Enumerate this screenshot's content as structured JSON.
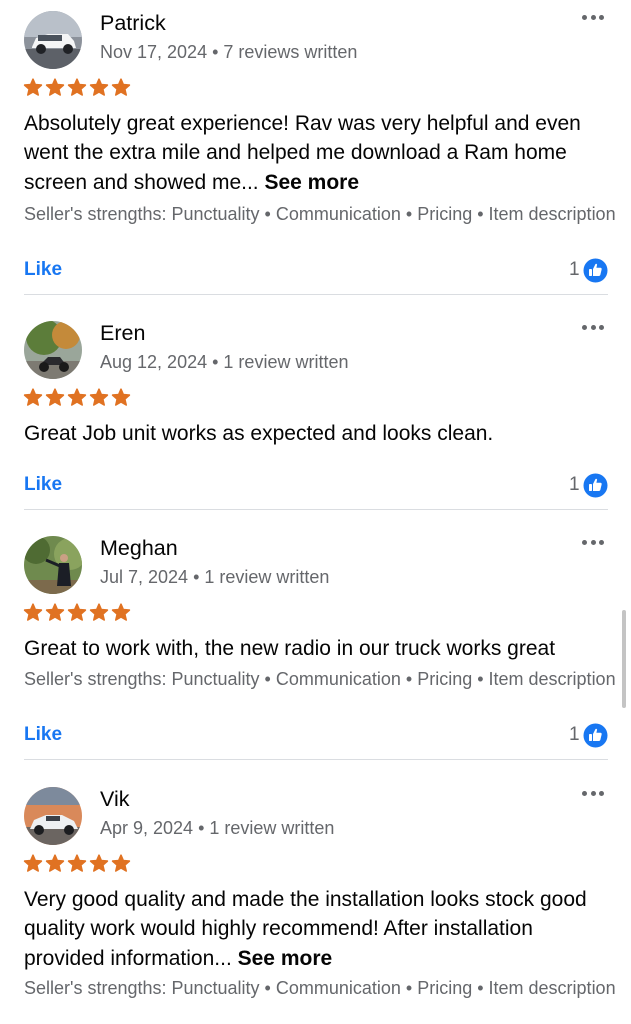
{
  "colors": {
    "star": "#e07222",
    "link": "#1877f2",
    "secondary_text": "#65676b",
    "divider": "#dadde1"
  },
  "reviews": [
    {
      "name": "Patrick",
      "date": "Nov 17, 2024",
      "review_count": "7 reviews written",
      "rating": 5,
      "text": "Absolutely great experience! Rav was very helpful and even went the extra mile and helped me download a Ram home screen and showed me...",
      "see_more": "See more",
      "strengths": "Seller's strengths: Punctuality • Communication • Pricing • Item description",
      "like_label": "Like",
      "like_count": "1",
      "avatar_icon": "white-pickup-truck-avatar"
    },
    {
      "name": "Eren",
      "date": "Aug 12, 2024",
      "review_count": "1 review written",
      "rating": 5,
      "text": "Great Job unit works as expected and looks clean.",
      "like_label": "Like",
      "like_count": "1",
      "avatar_icon": "motorcycle-under-tree-avatar"
    },
    {
      "name": "Meghan",
      "date": "Jul 7, 2024",
      "review_count": "1 review written",
      "rating": 5,
      "text": "Great to work with, the new radio in our truck works great",
      "strengths": "Seller's strengths: Punctuality • Communication • Pricing • Item description",
      "like_label": "Like",
      "like_count": "1",
      "avatar_icon": "person-in-trees-avatar"
    },
    {
      "name": "Vik",
      "date": "Apr 9, 2024",
      "review_count": "1 review written",
      "rating": 5,
      "text": "Very good quality and made the installation looks stock good quality work would highly recommend! After installation provided information...",
      "see_more": "See more",
      "strengths": "Seller's strengths: Punctuality • Communication • Pricing • Item description",
      "avatar_icon": "white-car-sunset-avatar"
    }
  ]
}
